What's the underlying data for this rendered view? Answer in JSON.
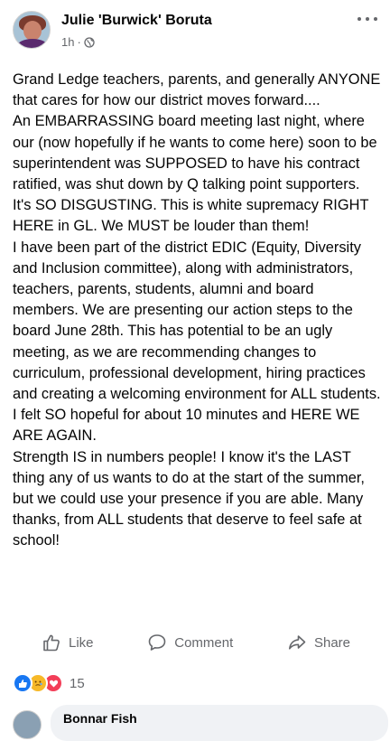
{
  "post": {
    "author": "Julie 'Burwick' Boruta",
    "time": "1h",
    "separator": "·",
    "privacy_icon": "globe-icon",
    "text": "Grand Ledge teachers, parents, and generally ANYONE that cares for how our district moves forward....\nAn EMBARRASSING board meeting last night, where our (now hopefully if he wants to come here) soon to be superintendent was SUPPOSED to have his contract ratified, was shut down by Q talking point supporters.  It's SO DISGUSTING. This is white supremacy RIGHT HERE in GL.  We MUST be louder than them!\nI have been part of the district EDIC (Equity, Diversity and Inclusion committee), along with administrators, teachers, parents, students, alumni and board members. We are presenting our action steps to the board June 28th.  This has potential to be an ugly meeting, as we are recommending changes to curriculum, professional development, hiring practices and creating a welcoming environment for ALL students.  I felt SO hopeful for about 10 minutes and HERE WE ARE AGAIN.\nStrength IS in numbers people!  I know it's the LAST thing any of us wants to do at the start of the summer, but we could use your presence if you are able.  Many thanks, from ALL students that deserve to feel safe at school!"
  },
  "actions": {
    "like": "Like",
    "comment": "Comment",
    "share": "Share"
  },
  "reactions": {
    "icons": [
      "like-reaction-icon",
      "care-reaction-icon",
      "love-reaction-icon"
    ],
    "count": "15"
  },
  "comment_preview": {
    "name": "Bonnar Fish"
  },
  "colors": {
    "text": "#050505",
    "secondary": "#65676b",
    "like_blue": "#1877f2",
    "love_red": "#f33e58",
    "care_yellow": "#f7b928",
    "comment_bg": "#f0f2f5"
  }
}
